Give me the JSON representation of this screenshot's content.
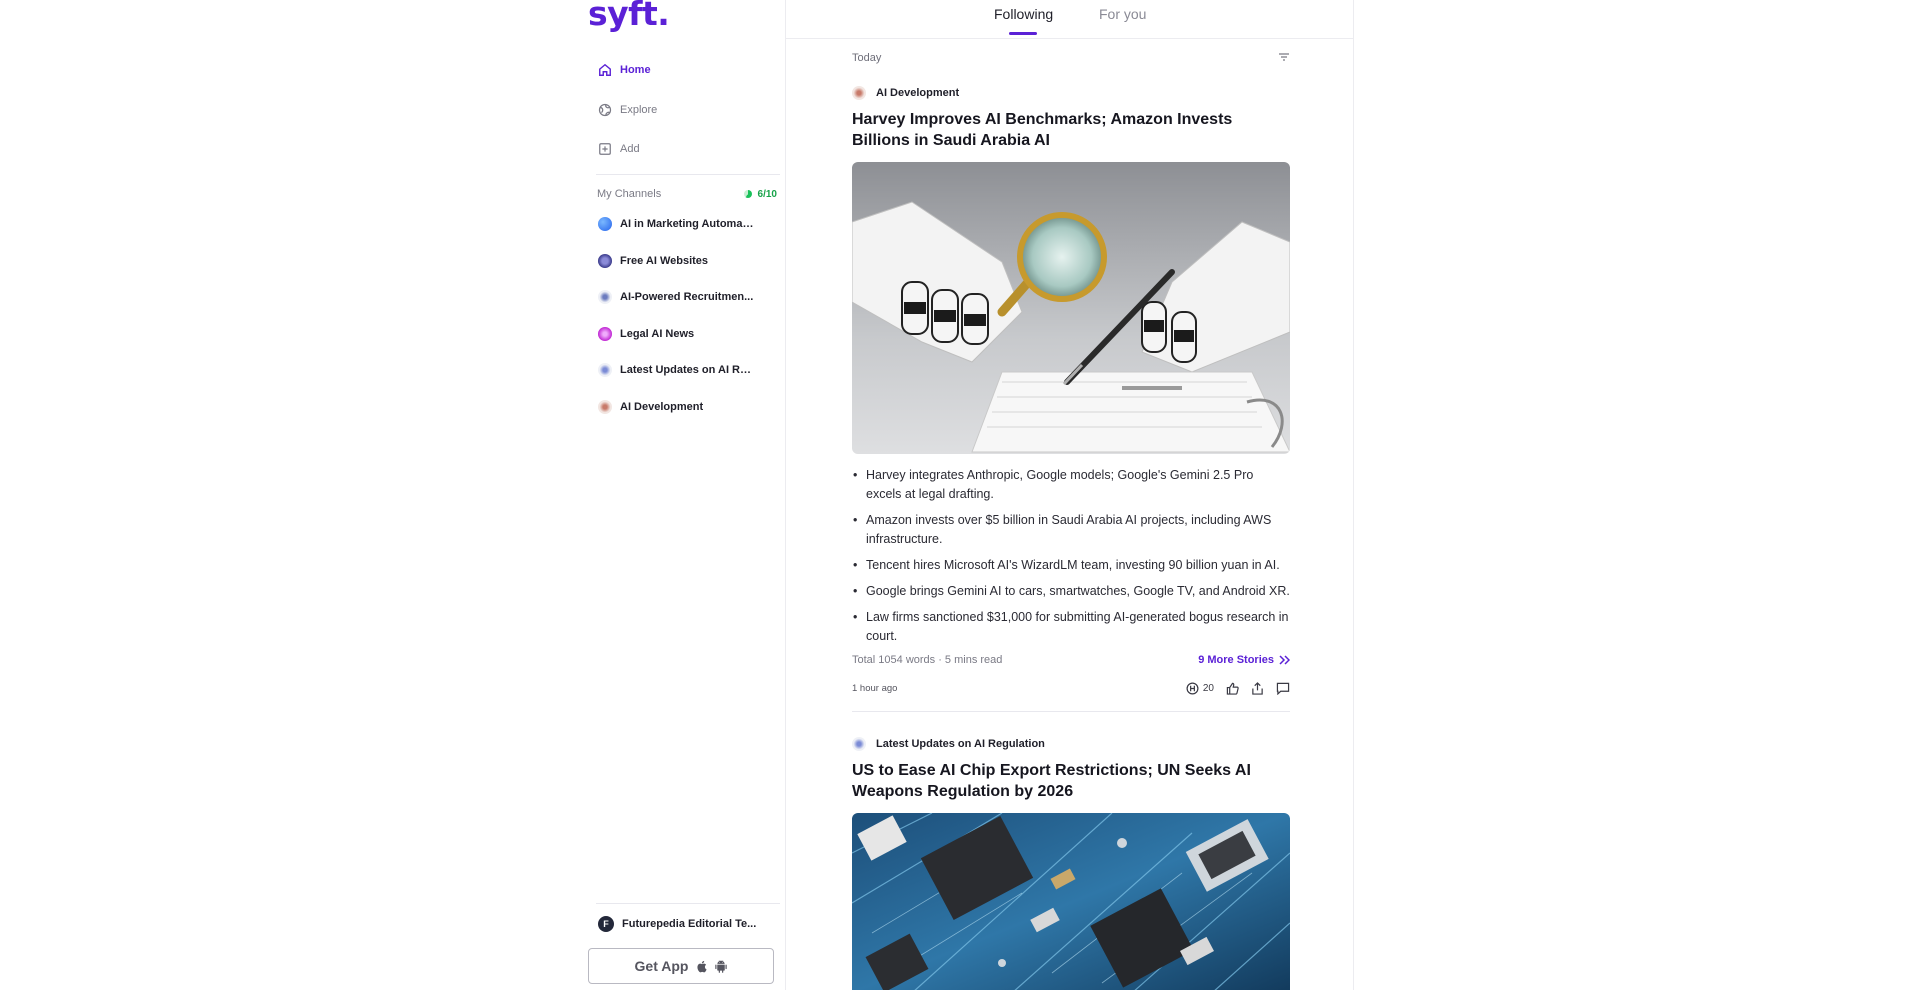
{
  "brand": {
    "logo": "syft."
  },
  "nav": [
    {
      "label": "Home",
      "icon": "home-icon",
      "active": true
    },
    {
      "label": "Explore",
      "icon": "globe-icon",
      "active": false
    },
    {
      "label": "Add",
      "icon": "plus-square-icon",
      "active": false
    }
  ],
  "channels": {
    "heading": "My Channels",
    "count": "6/10",
    "items": [
      {
        "name": "AI in Marketing Automati...",
        "color": "#3b82f6"
      },
      {
        "name": "Free AI Websites",
        "color": "#4b4b9b"
      },
      {
        "name": "AI-Powered Recruitmen...",
        "color": "#e5e7f0"
      },
      {
        "name": "Legal AI News",
        "color": "#d946ef"
      },
      {
        "name": "Latest Updates on AI Re...",
        "color": "#e5e7f0"
      },
      {
        "name": "AI Development",
        "color": "#e8d8d0"
      }
    ]
  },
  "profile": {
    "initial": "F",
    "name": "Futurepedia Editorial Te..."
  },
  "get_app": {
    "label": "Get App"
  },
  "tabs": [
    {
      "label": "Following",
      "active": true
    },
    {
      "label": "For you",
      "active": false
    }
  ],
  "feed": {
    "section": "Today",
    "cards": [
      {
        "channel": "AI Development",
        "title": "Harvey Improves AI Benchmarks; Amazon Invests Billions in Saudi Arabia AI",
        "bullets": [
          "Harvey integrates Anthropic, Google models; Google's Gemini 2.5 Pro excels at legal drafting.",
          "Amazon invests over $5 billion in Saudi Arabia AI projects, including AWS infrastructure.",
          "Tencent hires Microsoft AI's WizardLM team, investing 90 billion yuan in AI.",
          "Google brings Gemini AI to cars, smartwatches, Google TV, and Android XR.",
          "Law firms sanctioned $31,000 for submitting AI-generated bogus research in court."
        ],
        "stats": "Total 1054 words · 5 mins read",
        "more": "9 More Stories",
        "time": "1 hour ago",
        "reactions": "20"
      },
      {
        "channel": "Latest Updates on AI Regulation",
        "title": "US to Ease AI Chip Export Restrictions; UN Seeks AI Weapons Regulation by 2026"
      }
    ]
  },
  "colors": {
    "accent": "#5b21d6",
    "count_green": "#19a34a"
  }
}
